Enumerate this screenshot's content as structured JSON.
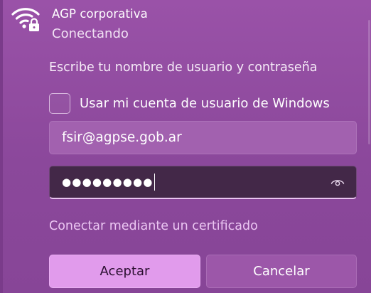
{
  "network": {
    "name": "AGP corporativa",
    "status": "Conectando"
  },
  "auth": {
    "prompt": "Escribe tu nombre de usuario y contraseña",
    "use_windows_account_label": "Usar mi cuenta de usuario de Windows",
    "use_windows_account_checked": false,
    "username_value": "fsir@agpse.gob.ar",
    "password_masked": "●●●●●●●●●",
    "certificate_link": "Conectar mediante un certificado"
  },
  "buttons": {
    "accept_label": "Aceptar",
    "cancel_label": "Cancelar"
  },
  "icons": {
    "network": "wifi-secured-icon",
    "reveal_password": "eye-icon"
  },
  "colors": {
    "background": "#8e4a9e",
    "accent_button": "#e19bec",
    "link": "#ebc6f2",
    "password_field": "#432848"
  }
}
